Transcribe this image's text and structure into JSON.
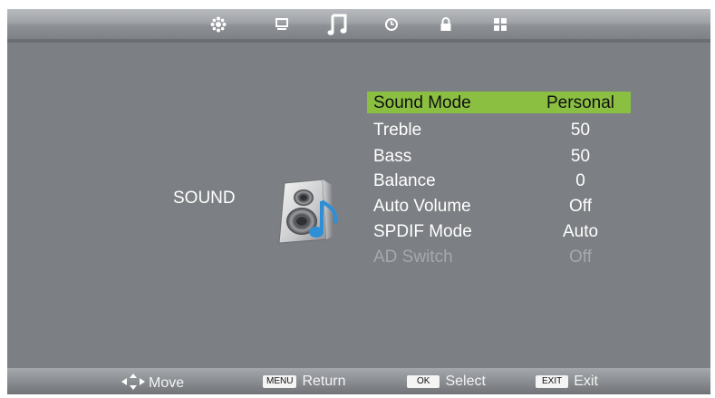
{
  "top_icons": [
    "picture-settings-icon",
    "monitor-icon",
    "music-note-icon",
    "clock-icon",
    "lock-icon",
    "grid-icon"
  ],
  "section": {
    "title": "SOUND",
    "icon": "speaker-icon"
  },
  "menu": {
    "rows": [
      {
        "label": "Sound Mode",
        "value": "Personal",
        "state": "selected"
      },
      {
        "label": "Treble",
        "value": "50",
        "state": "normal"
      },
      {
        "label": "Bass",
        "value": "50",
        "state": "normal"
      },
      {
        "label": "Balance",
        "value": "0",
        "state": "normal"
      },
      {
        "label": "Auto Volume",
        "value": "Off",
        "state": "normal"
      },
      {
        "label": "SPDIF Mode",
        "value": "Auto",
        "state": "normal"
      },
      {
        "label": "AD Switch",
        "value": "Off",
        "state": "disabled"
      }
    ]
  },
  "footer": {
    "move": {
      "icon": "direction-arrows-icon",
      "label": "Move"
    },
    "return": {
      "key": "MENU",
      "label": "Return"
    },
    "select": {
      "key": "OK",
      "label": "Select"
    },
    "exit": {
      "key": "EXIT",
      "label": "Exit"
    }
  },
  "colors": {
    "highlight": "#8bbf42",
    "background": "#7c7f83",
    "disabled_text": "#a6a8ab",
    "speaker_note": "#2e8fd6"
  }
}
